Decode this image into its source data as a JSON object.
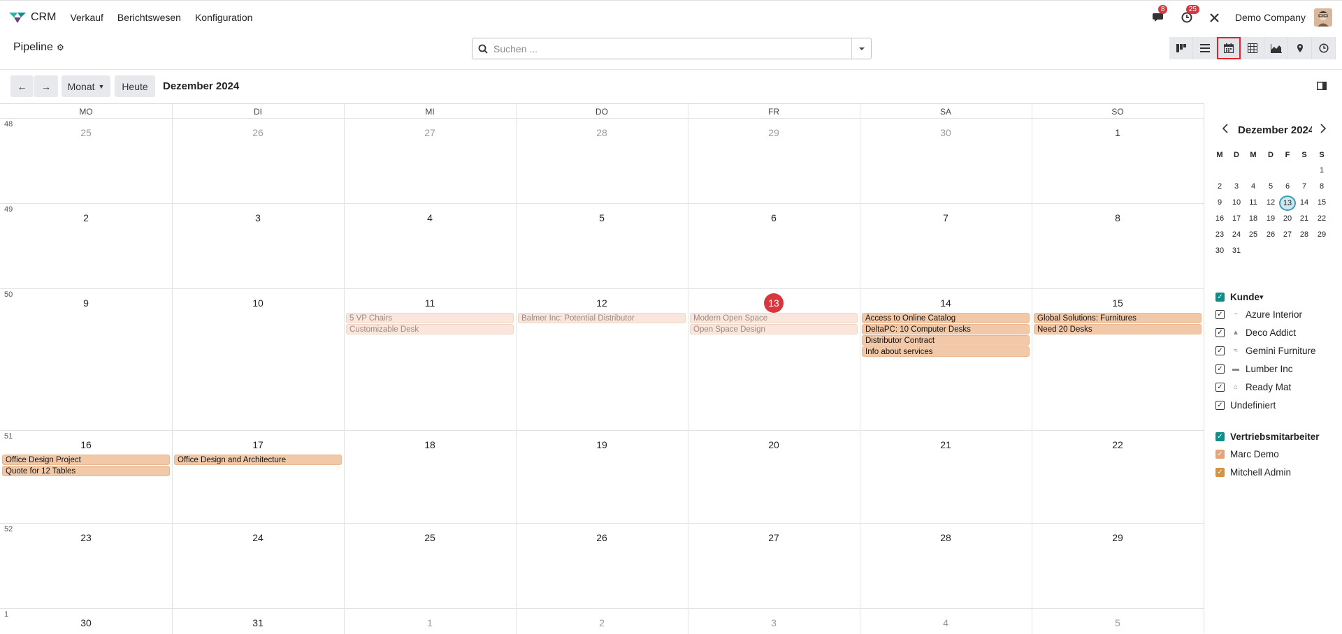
{
  "app": {
    "name": "CRM",
    "menu": [
      "Verkauf",
      "Berichtswesen",
      "Konfiguration"
    ]
  },
  "nav": {
    "messages_count": "8",
    "activities_count": "25",
    "company": "Demo Company"
  },
  "control": {
    "title": "Pipeline",
    "search_placeholder": "Suchen ...",
    "views": [
      "kanban-icon",
      "list-icon",
      "calendar-icon",
      "pivot-icon",
      "graph-icon",
      "map-icon",
      "activity-icon"
    ],
    "active_view": "calendar-icon"
  },
  "calendar_bar": {
    "prev": "←",
    "next": "→",
    "scale": "Monat",
    "today": "Heute",
    "range": "Dezember 2024"
  },
  "weekdays": [
    "MO",
    "DI",
    "MI",
    "DO",
    "FR",
    "SA",
    "SO"
  ],
  "weeks": [
    {
      "num": "48",
      "days": [
        "25",
        "26",
        "27",
        "28",
        "29",
        "30",
        "1"
      ],
      "other": [
        true,
        true,
        true,
        true,
        true,
        true,
        false
      ]
    },
    {
      "num": "49",
      "days": [
        "2",
        "3",
        "4",
        "5",
        "6",
        "7",
        "8"
      ],
      "other": [
        false,
        false,
        false,
        false,
        false,
        false,
        false
      ]
    },
    {
      "num": "50",
      "days": [
        "9",
        "10",
        "11",
        "12",
        "13",
        "14",
        "15"
      ],
      "other": [
        false,
        false,
        false,
        false,
        false,
        false,
        false
      ]
    },
    {
      "num": "51",
      "days": [
        "16",
        "17",
        "18",
        "19",
        "20",
        "21",
        "22"
      ],
      "other": [
        false,
        false,
        false,
        false,
        false,
        false,
        false
      ]
    },
    {
      "num": "52",
      "days": [
        "23",
        "24",
        "25",
        "26",
        "27",
        "28",
        "29"
      ],
      "other": [
        false,
        false,
        false,
        false,
        false,
        false,
        false
      ]
    },
    {
      "num": "1",
      "days": [
        "30",
        "31",
        "1",
        "2",
        "3",
        "4",
        "5"
      ],
      "other": [
        false,
        false,
        true,
        true,
        true,
        true,
        true
      ]
    }
  ],
  "today": "13",
  "events": [
    {
      "week": 2,
      "day": 2,
      "slot": 0,
      "title": "5 VP Chairs",
      "past": true
    },
    {
      "week": 2,
      "day": 2,
      "slot": 1,
      "title": "Customizable Desk",
      "past": true
    },
    {
      "week": 2,
      "day": 3,
      "slot": 0,
      "title": "Balmer Inc: Potential Distributor",
      "past": true
    },
    {
      "week": 2,
      "day": 4,
      "slot": 0,
      "title": "Modern Open Space",
      "past": true
    },
    {
      "week": 2,
      "day": 4,
      "slot": 1,
      "title": "Open Space Design",
      "past": true
    },
    {
      "week": 2,
      "day": 5,
      "slot": 0,
      "title": "Access to Online Catalog",
      "past": false
    },
    {
      "week": 2,
      "day": 5,
      "slot": 1,
      "title": "DeltaPC: 10 Computer Desks",
      "past": false
    },
    {
      "week": 2,
      "day": 5,
      "slot": 2,
      "title": "Distributor Contract",
      "past": false
    },
    {
      "week": 2,
      "day": 5,
      "slot": 3,
      "title": "Info about services",
      "past": false
    },
    {
      "week": 2,
      "day": 6,
      "slot": 0,
      "title": "Global Solutions: Furnitures",
      "past": false
    },
    {
      "week": 2,
      "day": 6,
      "slot": 1,
      "title": "Need 20 Desks",
      "past": false
    },
    {
      "week": 3,
      "day": 0,
      "slot": 0,
      "title": "Office Design Project",
      "past": false
    },
    {
      "week": 3,
      "day": 0,
      "slot": 1,
      "title": "Quote for 12 Tables",
      "past": false
    },
    {
      "week": 3,
      "day": 1,
      "slot": 0,
      "title": "Office Design and Architecture",
      "past": false
    }
  ],
  "mini": {
    "title": "Dezember 2024",
    "head": [
      "M",
      "D",
      "M",
      "D",
      "F",
      "S",
      "S"
    ],
    "rows": [
      [
        "",
        "",
        "",
        "",
        "",
        "",
        "1"
      ],
      [
        "2",
        "3",
        "4",
        "5",
        "6",
        "7",
        "8"
      ],
      [
        "9",
        "10",
        "11",
        "12",
        "13",
        "14",
        "15"
      ],
      [
        "16",
        "17",
        "18",
        "19",
        "20",
        "21",
        "22"
      ],
      [
        "23",
        "24",
        "25",
        "26",
        "27",
        "28",
        "29"
      ],
      [
        "30",
        "31",
        "",
        "",
        "",
        "",
        ""
      ]
    ],
    "selected": "13"
  },
  "filters": {
    "kunde": {
      "label": "Kunde",
      "items": [
        "Azure Interior",
        "Deco Addict",
        "Gemini Furniture",
        "Lumber Inc",
        "Ready Mat",
        "Undefiniert"
      ]
    },
    "sales": {
      "label": "Vertriebsmitarbeiter",
      "items": [
        "Marc Demo",
        "Mitchell Admin"
      ]
    }
  }
}
